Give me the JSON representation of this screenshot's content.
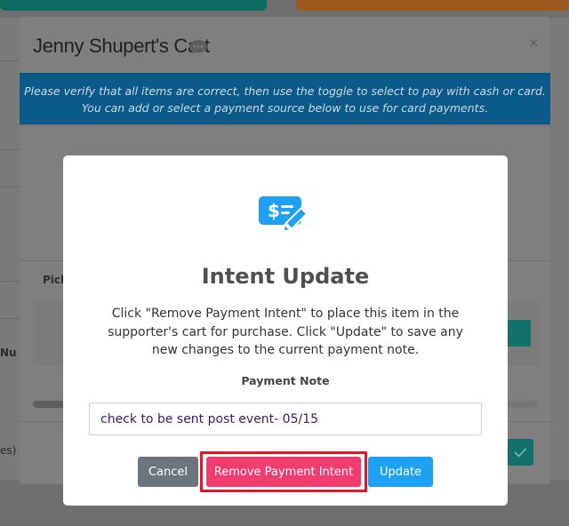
{
  "cart_modal": {
    "title": "Jenny Shupert's Cart",
    "close_label": "×",
    "banner_line1": "Please verify that all items are correct, then use the toggle to select to pay with cash or card.",
    "banner_line2": "You can add or select a payment source below to use for card payments.",
    "pick_label": "Pick"
  },
  "background": {
    "left_label_1": "Nu",
    "left_label_2": "es)"
  },
  "dialog": {
    "title": "Intent Update",
    "message": "Click \"Remove Payment Intent\" to place this item in the supporter's cart for purchase. Click \"Update\" to save any new changes to the current payment note.",
    "note_label": "Payment Note",
    "note_value": "check to be sent post event- 05/15",
    "buttons": {
      "cancel": "Cancel",
      "remove": "Remove Payment Intent",
      "update": "Update"
    }
  },
  "colors": {
    "accent": "#1ea1f2",
    "remove_button": "#f03c6e",
    "highlight_border": "#e31528",
    "cancel_button": "#6c757d"
  },
  "icons": {
    "dialog_icon": "payment-check-edit-icon",
    "chat_icon": "chat-bubble-icon"
  }
}
